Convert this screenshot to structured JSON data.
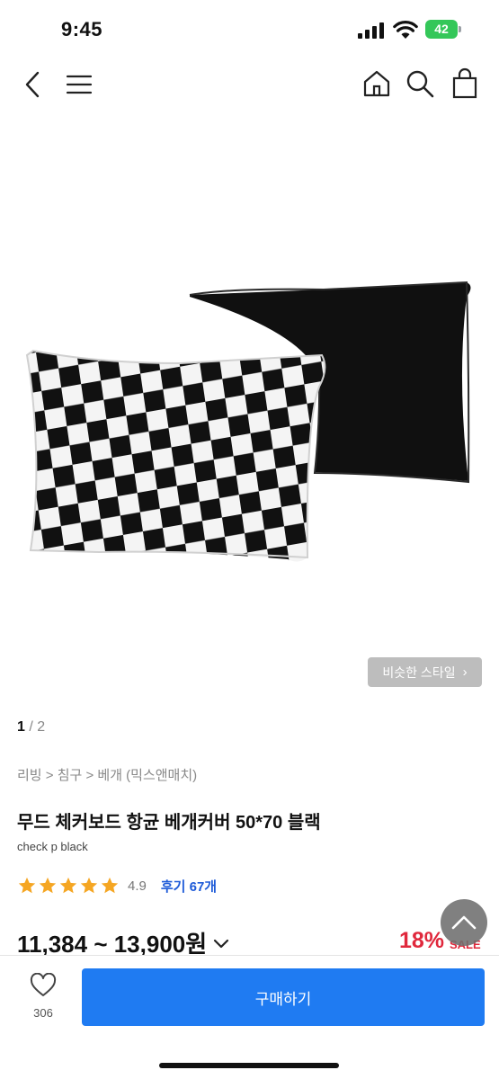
{
  "status_bar": {
    "time": "9:45",
    "battery": "42"
  },
  "nav": {
    "icons": [
      "back-icon",
      "menu-icon",
      "home-icon",
      "search-icon",
      "shopping-bag-icon"
    ]
  },
  "gallery": {
    "similar_style_label": "비슷한 스타일",
    "current_page": "1",
    "page_separator": " / ",
    "total_pages": "2"
  },
  "product": {
    "breadcrumb": "리빙 > 침구 > 베개 (믹스앤매치)",
    "title": "무드 체커보드 항균 베개커버 50*70 블랙",
    "subtitle": "check p black",
    "rating": {
      "stars": 5,
      "value": "4.9",
      "review_label": "후기 67개"
    },
    "price": "11,384 ~ 13,900원",
    "discount": "18%",
    "sale_label": "SALE"
  },
  "bottom_bar": {
    "like_count": "306",
    "buy_label": "구매하기"
  },
  "colors": {
    "buy_button": "#1f7bf2",
    "discount": "#e0283c",
    "review_link": "#1e5bd8",
    "star": "#f5a623",
    "battery": "#34c759"
  }
}
